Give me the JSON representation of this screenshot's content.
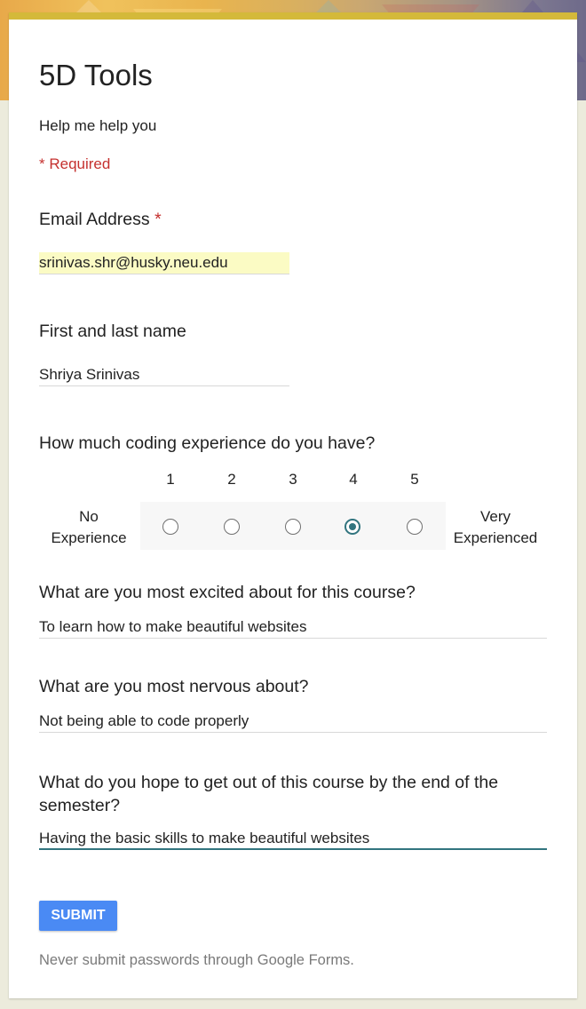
{
  "form": {
    "title": "5D Tools",
    "description": "Help me help you",
    "required_note": "* Required"
  },
  "questions": {
    "email": {
      "label": "Email Address",
      "required_mark": "*",
      "value": "srinivas.shr@husky.neu.edu"
    },
    "name": {
      "label": "First and last name",
      "value": "Shriya Srinivas"
    },
    "coding": {
      "label": "How much coding experience do you have?",
      "scale": [
        "1",
        "2",
        "3",
        "4",
        "5"
      ],
      "selected": "4",
      "low_label_line1": "No",
      "low_label_line2": "Experience",
      "high_label_line1": "Very",
      "high_label_line2": "Experienced"
    },
    "excited": {
      "label": "What are you most excited about for this course?",
      "value": "To learn how to make beautiful websites"
    },
    "nervous": {
      "label": "What are you most nervous about?",
      "value": "Not being able to code properly"
    },
    "hope": {
      "label_line1": "What do you hope to get out of this course by the end of the",
      "label_line2": "semester?",
      "value": "Having the basic skills to make beautiful websites"
    }
  },
  "submit_label": "SUBMIT",
  "footer_note": "Never submit passwords through Google Forms.",
  "colors": {
    "accent": "#32757f",
    "required": "#c5312f",
    "submit": "#4a8af4",
    "header_bar": "#d4b93a"
  }
}
